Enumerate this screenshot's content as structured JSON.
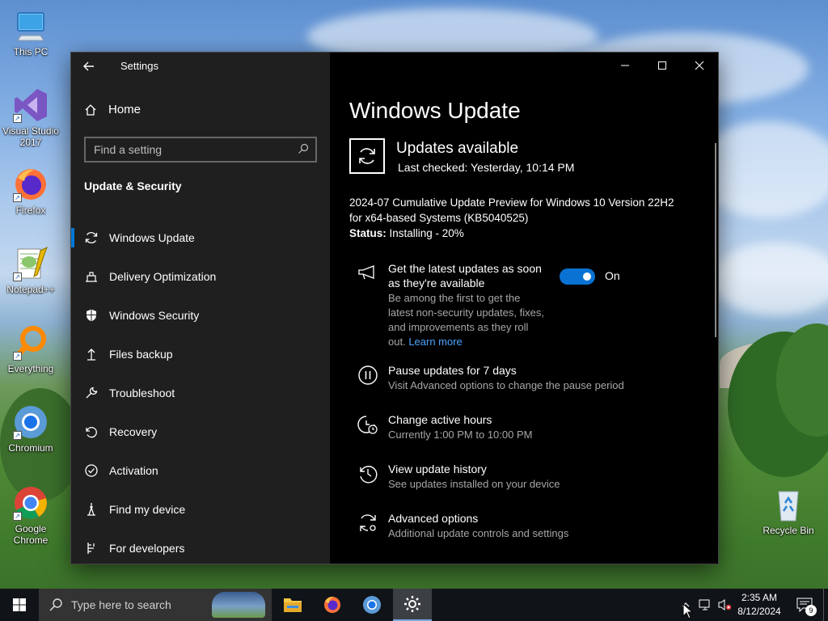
{
  "desktop": {
    "icons": [
      {
        "label": "This PC"
      },
      {
        "label": "Visual Studio 2017"
      },
      {
        "label": "Firefox"
      },
      {
        "label": "Notepad++"
      },
      {
        "label": "Everything"
      },
      {
        "label": "Chromium"
      },
      {
        "label": "Google Chrome"
      },
      {
        "label": "Recycle Bin"
      }
    ]
  },
  "settings": {
    "app_title": "Settings",
    "home_label": "Home",
    "search_placeholder": "Find a setting",
    "section_title": "Update & Security",
    "nav": [
      {
        "label": "Windows Update",
        "icon": "sync-icon",
        "selected": true
      },
      {
        "label": "Delivery Optimization",
        "icon": "delivery-icon"
      },
      {
        "label": "Windows Security",
        "icon": "shield-icon"
      },
      {
        "label": "Files backup",
        "icon": "backup-icon"
      },
      {
        "label": "Troubleshoot",
        "icon": "wrench-icon"
      },
      {
        "label": "Recovery",
        "icon": "recovery-icon"
      },
      {
        "label": "Activation",
        "icon": "check-circle-icon"
      },
      {
        "label": "Find my device",
        "icon": "find-device-icon"
      },
      {
        "label": "For developers",
        "icon": "developer-icon"
      }
    ],
    "main": {
      "title": "Windows Update",
      "status_heading": "Updates available",
      "last_checked": "Last checked: Yesterday, 10:14 PM",
      "update_line1": "2024-07 Cumulative Update Preview for Windows 10 Version 22H2",
      "update_line2": "for x64-based Systems (KB5040525)",
      "status_label": "Status:",
      "status_value": " Installing - 20%",
      "latest_updates": {
        "title_line1": "Get the latest updates as soon",
        "title_line2": "as they're available",
        "desc_line1": "Be among the first to get the",
        "desc_line2": "latest non-security updates, fixes,",
        "desc_line3": "and improvements as they roll",
        "desc_line4_prefix": "out.",
        "learn_more": "Learn more",
        "toggle_label": "On",
        "toggle_on": true
      },
      "options": [
        {
          "title": "Pause updates for 7 days",
          "sub": "Visit Advanced options to change the pause period"
        },
        {
          "title": "Change active hours",
          "sub": "Currently 1:00 PM to 10:00 PM"
        },
        {
          "title": "View update history",
          "sub": "See updates installed on your device"
        },
        {
          "title": "Advanced options",
          "sub": "Additional update controls and settings"
        }
      ]
    }
  },
  "taskbar": {
    "search_placeholder": "Type here to search",
    "time": "2:35 AM",
    "date": "8/12/2024",
    "notification_count": "9"
  },
  "colors": {
    "accent": "#0078d7",
    "toggle_on": "#0a72d3",
    "link": "#4da3ff",
    "sidebar_bg": "#1f1f1f"
  }
}
